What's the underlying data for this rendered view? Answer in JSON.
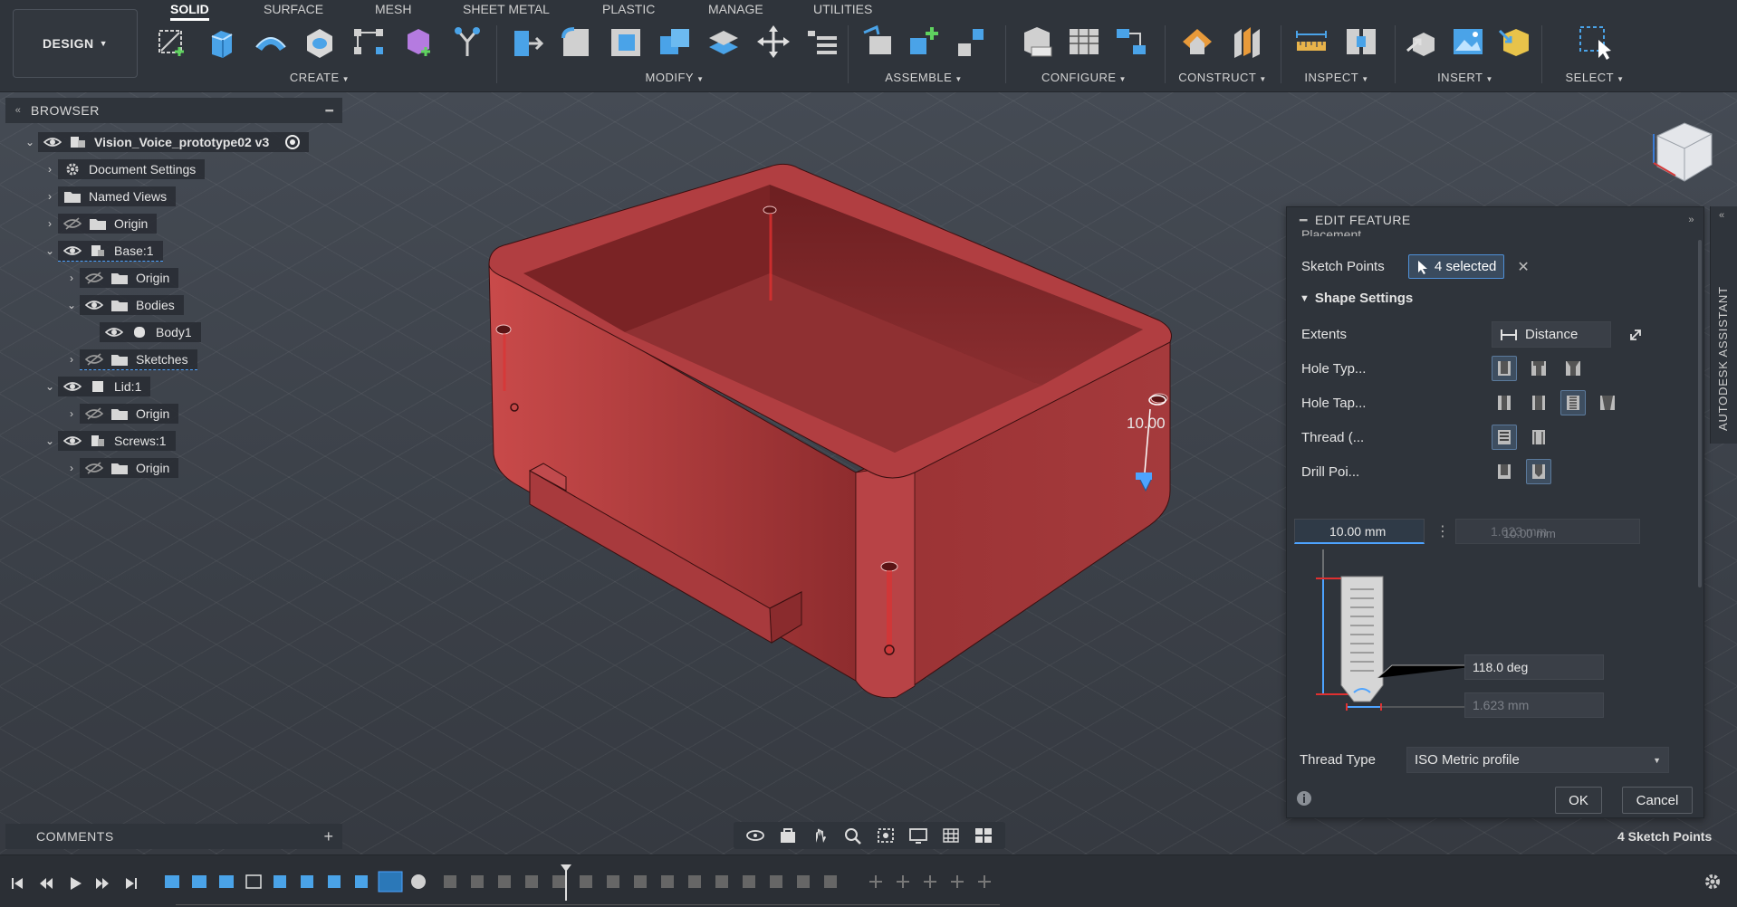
{
  "workspace": {
    "label": "DESIGN"
  },
  "tabs": [
    "SOLID",
    "SURFACE",
    "MESH",
    "SHEET METAL",
    "PLASTIC",
    "MANAGE",
    "UTILITIES"
  ],
  "groups": {
    "create": "CREATE",
    "modify": "MODIFY",
    "assemble": "ASSEMBLE",
    "configure": "CONFIGURE",
    "construct": "CONSTRUCT",
    "inspect": "INSPECT",
    "insert": "INSERT",
    "select": "SELECT"
  },
  "browser": {
    "title": "BROWSER",
    "items": [
      {
        "label": "Vision_Voice_prototype02 v3"
      },
      {
        "label": "Document Settings"
      },
      {
        "label": "Named Views"
      },
      {
        "label": "Origin"
      },
      {
        "label": "Base:1"
      },
      {
        "label": "Origin"
      },
      {
        "label": "Bodies"
      },
      {
        "label": "Body1"
      },
      {
        "label": "Sketches"
      },
      {
        "label": "Lid:1"
      },
      {
        "label": "Origin"
      },
      {
        "label": "Screws:1"
      },
      {
        "label": "Origin"
      }
    ]
  },
  "comments": {
    "title": "COMMENTS"
  },
  "viewport": {
    "dimension_label": "10.00"
  },
  "edit_feature": {
    "title": "EDIT FEATURE",
    "placement_label": "Placement",
    "sketch_points_label": "Sketch Points",
    "sketch_points_value": "4 selected",
    "shape_settings_label": "Shape Settings",
    "extents_label": "Extents",
    "extents_value": "Distance",
    "hole_type_label": "Hole Typ...",
    "hole_tap_label": "Hole Tap...",
    "thread_label": "Thread (...",
    "drill_point_label": "Drill Poi...",
    "depth_value": "10.00 mm",
    "depth2_value": "1.623 mm",
    "depth3_value": "10.00 mm",
    "angle_value": "118.0 deg",
    "diameter_value": "1.623 mm",
    "thread_type_label": "Thread Type",
    "thread_type_value": "ISO Metric profile",
    "ok_label": "OK",
    "cancel_label": "Cancel"
  },
  "assistant": {
    "label": "AUTODESK ASSISTANT"
  },
  "status": {
    "text": "4 Sketch Points"
  },
  "colors": {
    "accent": "#4da3ff",
    "body": "#a8383a",
    "panel": "#2f343b"
  }
}
